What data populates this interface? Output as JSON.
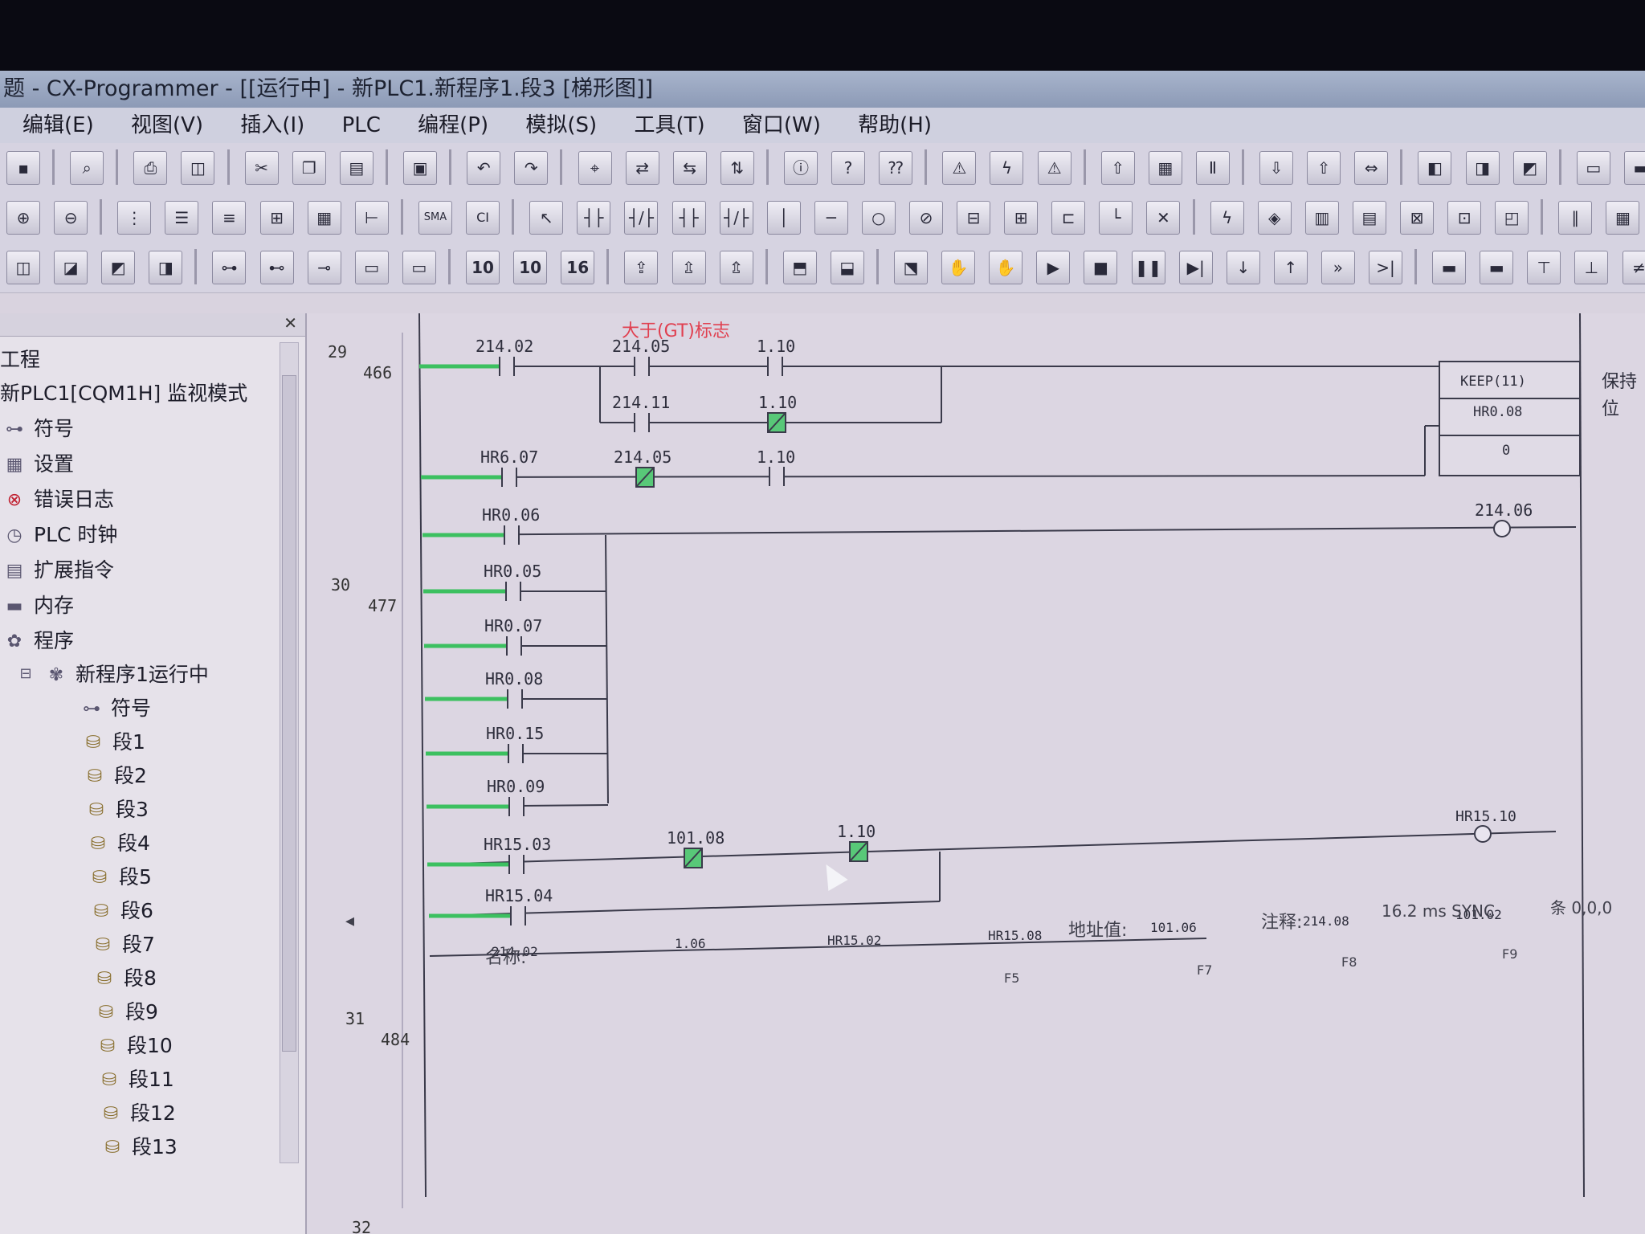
{
  "window": {
    "title": "题 - CX-Programmer - [[运行中] - 新PLC1.新程序1.段3 [梯形图]]"
  },
  "menu": [
    "编辑(E)",
    "视图(V)",
    "插入(I)",
    "PLC",
    "编程(P)",
    "模拟(S)",
    "工具(T)",
    "窗口(W)",
    "帮助(H)"
  ],
  "toolbar": {
    "radix_10": "10",
    "radix_10b": "10",
    "radix_16": "16",
    "sma": "SMA",
    "ci": "CI"
  },
  "sidebar": {
    "heading": "工程",
    "plc": "新PLC1[CQM1H] 监视模式",
    "items": [
      "符号",
      "设置",
      "错误日志",
      "PLC 时钟",
      "扩展指令",
      "内存",
      "程序"
    ],
    "program": "新程序1运行中",
    "program_items": [
      "符号",
      "段1",
      "段2",
      "段3",
      "段4",
      "段5",
      "段6",
      "段7",
      "段8",
      "段9",
      "段10",
      "段11",
      "段12",
      "段13"
    ]
  },
  "ladder": {
    "note": "大于(GT)标志",
    "rungs": [
      {
        "num": "29",
        "step": "466"
      },
      {
        "num": "30",
        "step": "477"
      },
      {
        "num": "31",
        "step": "484"
      },
      {
        "num": "32",
        "step": ""
      }
    ],
    "contacts": {
      "r29a": "214.02",
      "r29b": "214.05",
      "r29c": "1.10",
      "r29d": "214.11",
      "r29e": "1.10",
      "r29f": "HR6.07",
      "r29g": "214.05",
      "r29h": "1.10",
      "r30a": "HR0.06",
      "r30b": "HR0.05",
      "r30c": "HR0.07",
      "r30d": "HR0.08",
      "r30e": "HR0.15",
      "r30f": "HR0.09",
      "r31a": "HR15.03",
      "r31b": "101.08",
      "r31c": "1.10",
      "r31d": "HR15.04"
    },
    "keep": {
      "instr": "KEEP(11)",
      "operand": "HR0.08",
      "value": "0",
      "comment1": "保持",
      "comment2": "位"
    },
    "coils": {
      "c30": "214.06",
      "c31": "HR15.10"
    },
    "bottom_row": [
      "214.02",
      "1.06",
      "HR15.02",
      "HR15.08",
      "101.06",
      "214.08",
      "101.02"
    ]
  },
  "status": {
    "address_label": "地址值:",
    "comment_label": "注释:",
    "name_label": "名称:",
    "scan": "16.2 ms SYNC",
    "pos": "条 0,0,0",
    "fkeys": [
      "F5",
      "F7",
      "F8",
      "F9"
    ]
  }
}
